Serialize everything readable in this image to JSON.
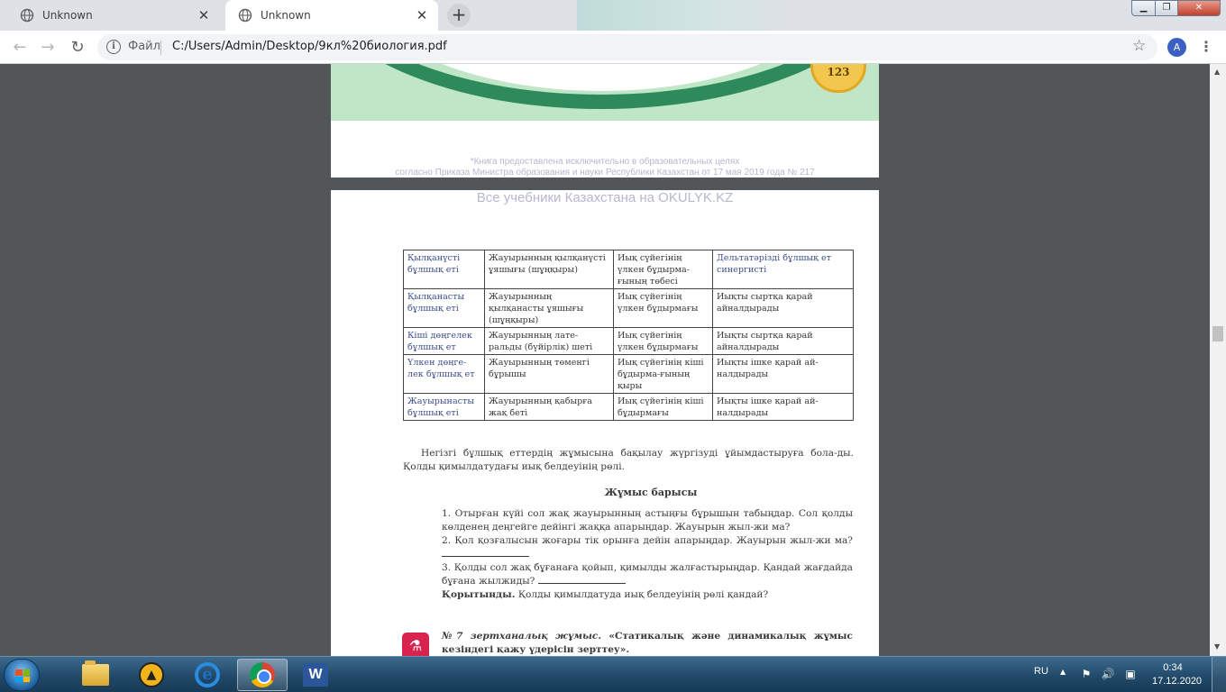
{
  "browser": {
    "tabs": [
      {
        "title": "Unknown",
        "active": false
      },
      {
        "title": "Unknown",
        "active": true
      }
    ],
    "new_tab_symbol": "+",
    "close_symbol": "✕",
    "address": {
      "scheme_label": "Файл",
      "url": "C:/Users/Admin/Desktop/9кл%20биология.pdf"
    },
    "profile_initial": "A",
    "icons": [
      "back-arrow-icon",
      "forward-arrow-icon",
      "reload-icon",
      "info-icon",
      "star-icon",
      "kebab-menu-icon",
      "globe-icon"
    ]
  },
  "pdf": {
    "page_top": {
      "page_number": "123",
      "notice_line1": "*Книга предоставлена исключительно в образовательных целях",
      "notice_line2": "согласно Приказа Министра образования и науки Республики Казахстан от 17 мая 2019 года № 217"
    },
    "page_main": {
      "watermark": "Все учебники Казахстана на OKULYK.KZ",
      "table_rows": [
        [
          "Қылқанүсті бұлшық еті",
          "Жауырынның қылқанүсті ұяшығы (шұңқыры)",
          "Иық сүйегінің үлкен бұдырма-ғының төбесі",
          "Дельтатәріздi бұлшық ет синергисті"
        ],
        [
          "Қылқанасты бұлшық еті",
          "Жауырынның қылқанасты ұяшығы (шұңқыры)",
          "Иық сүйегінің үлкен бұдырмағы",
          "Иықты сыртқа қарай айналдырады"
        ],
        [
          "Кіші дөңгелек бұлшық ет",
          "Жауырынның лате-ральды (бүйірлік) шеті",
          "Иық сүйегінің үлкен бұдырмағы",
          "Иықты сыртқа қарай айналдырады"
        ],
        [
          "Үлкен дөңге-лек бұлшық ет",
          "Жауырынның төменгі бұрышы",
          "Иық сүйегінің кіші бұдырма-ғының қыры",
          "Иықты ішке қарай ай-налдырады"
        ],
        [
          "Жауырынасты бұлшық еті",
          "Жауырынның қабырға жақ беті",
          "Иық сүйегінің кіші бұдырмағы",
          "Иықты ішке қарай ай-налдырады"
        ]
      ],
      "intro": "Негізгі бұлшық еттердің жұмысына бақылау жүргізуді ұйымдастыруға бола-ды. Қолды қимылдатудағы иық белдеуінің рөлі.",
      "heading": "Жұмыс барысы",
      "step1": "1. Отырған күйі сол жақ жауырынның астыңғы бұрышын табыңдар. Сол қолды көлденең деңгейге дейінгі жаққа апарыңдар. Жауырын жыл-жи ма?",
      "step2": "2. Қол қозғалысын жоғары тік орынға дейін апарыңдар. Жауырын жыл-жи ма?",
      "step3": "3. Қолды сол жақ бұғанаға қойып, қимылды жалғастырыңдар. Қандай жағдайда бұғана жылжиды?",
      "conclusion_label": "Қорытынды.",
      "conclusion_text": "Қолды қимылдатуда иық белдеуінің рөлі қандай?",
      "lab_label": "№7 зертханалық жұмыс.",
      "lab_title": "«Статикалық және динамикалық жұмыс кезіндегі қажу үдерісін зерттеу»."
    }
  },
  "taskbar": {
    "apps": [
      "windows-explorer",
      "warning-app",
      "internet-explorer",
      "google-chrome",
      "microsoft-word"
    ],
    "active_app": "google-chrome",
    "language": "RU",
    "time": "0:34",
    "date": "17.12.2020",
    "tray_icons": [
      "show-hidden-icons",
      "action-center-flag-icon",
      "volume-icon",
      "network-icon"
    ]
  }
}
